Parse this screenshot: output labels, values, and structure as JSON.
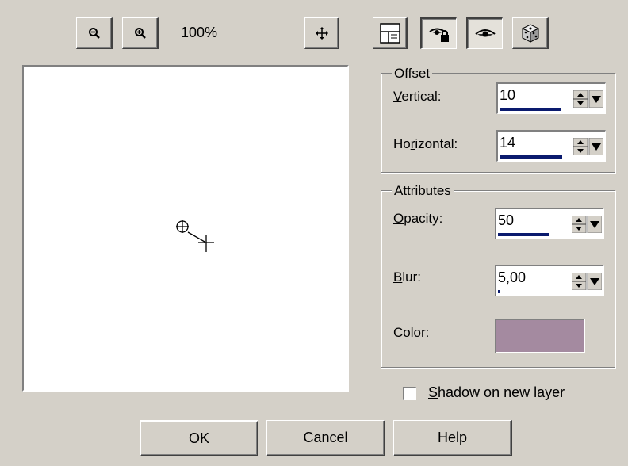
{
  "toolbar": {
    "zoom_out_icon": "zoom-out-icon",
    "zoom_in_icon": "zoom-in-icon",
    "zoom_level": "100%",
    "move_icon": "move-icon",
    "layout_icon": "layout-icon",
    "auto_proof_icon": "auto-proof-icon",
    "proof_icon": "proof-icon",
    "randomize_icon": "randomize-icon"
  },
  "offset": {
    "legend": "Offset",
    "vertical_label_u": "V",
    "vertical_label_rest": "ertical:",
    "vertical_value": "10",
    "vertical_fill": 0.6,
    "horizontal_label_pre": "Ho",
    "horizontal_label_u": "r",
    "horizontal_label_rest": "izontal:",
    "horizontal_value": "14",
    "horizontal_fill": 0.62
  },
  "attributes": {
    "legend": "Attributes",
    "opacity_label_u": "O",
    "opacity_label_rest": "pacity:",
    "opacity_value": "50",
    "opacity_fill": 0.5,
    "blur_label_u": "B",
    "blur_label_rest": "lur:",
    "blur_value": "5,00",
    "blur_fill": 0.02,
    "color_label_u": "C",
    "color_label_rest": "olor:",
    "color_value": "#a48aa0"
  },
  "shadow_layer": {
    "label_u": "S",
    "label_rest": "hadow on new layer",
    "checked": false
  },
  "buttons": {
    "ok": "OK",
    "cancel": "Cancel",
    "help": "Help"
  }
}
